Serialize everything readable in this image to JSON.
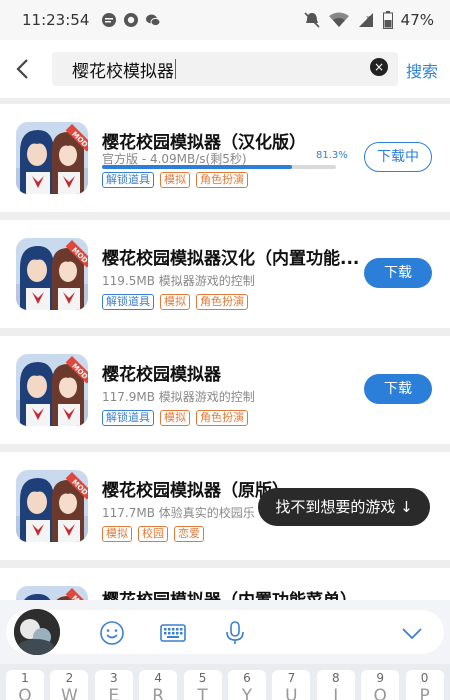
{
  "status_bar": {
    "time": "11:23:54",
    "battery_percent": "47%",
    "icons": [
      "chat-bubble-icon",
      "record-icon",
      "wechat-icon",
      "mute-icon",
      "wifi-icon",
      "signal-icon",
      "battery-icon"
    ]
  },
  "search": {
    "query": "樱花校模拟器",
    "clear_icon": "×",
    "button_label": "搜索"
  },
  "results": [
    {
      "title": "樱花校园模拟器（汉化版）",
      "subtitle": "官方版 - 4.09MB/s(剩5秒)",
      "progress": 0.813,
      "progress_label": "81.3%",
      "tags": [
        {
          "label": "解锁道具",
          "color": "blue"
        },
        {
          "label": "模拟",
          "color": "orange"
        },
        {
          "label": "角色扮演",
          "color": "orange"
        }
      ],
      "button_label": "下载中",
      "button_style": "outline"
    },
    {
      "title": "樱花校园模拟器汉化（内置功能...",
      "subtitle": "119.5MB  模拟器游戏的控制",
      "tags": [
        {
          "label": "解锁道具",
          "color": "blue"
        },
        {
          "label": "模拟",
          "color": "orange"
        },
        {
          "label": "角色扮演",
          "color": "orange"
        }
      ],
      "button_label": "下载",
      "button_style": "filled"
    },
    {
      "title": "樱花校园模拟器",
      "subtitle": "117.9MB  模拟器游戏的控制",
      "tags": [
        {
          "label": "解锁道具",
          "color": "blue"
        },
        {
          "label": "模拟",
          "color": "orange"
        },
        {
          "label": "角色扮演",
          "color": "orange"
        }
      ],
      "button_label": "下载",
      "button_style": "filled"
    },
    {
      "title": "樱花校园模拟器（原版）",
      "subtitle": "117.7MB  体验真实的校园乐",
      "tags": [
        {
          "label": "模拟",
          "color": "orange"
        },
        {
          "label": "校园",
          "color": "orange"
        },
        {
          "label": "恋爱",
          "color": "orange"
        }
      ],
      "button_label": "",
      "button_style": "hidden"
    },
    {
      "title": "樱花校园模拟器（内置功能菜单）",
      "subtitle": "",
      "tags": [],
      "button_label": "",
      "button_style": "hidden"
    }
  ],
  "toast": {
    "text": "找不到想要的游戏 ↓"
  },
  "keyboard": {
    "toolbar_icons": [
      "avatar",
      "emoji-icon",
      "keyboard-icon",
      "microphone-icon",
      "collapse-chevron-icon"
    ],
    "number_row": [
      "1",
      "2",
      "3",
      "4",
      "5",
      "6",
      "7",
      "8",
      "9",
      "0"
    ],
    "letter_row": [
      "Q",
      "W",
      "E",
      "R",
      "T",
      "Y",
      "U",
      "I",
      "O",
      "P"
    ]
  },
  "colors": {
    "accent": "#2b7fd8",
    "tag_blue": "#3b7fd0",
    "tag_orange": "#e07a3a"
  }
}
